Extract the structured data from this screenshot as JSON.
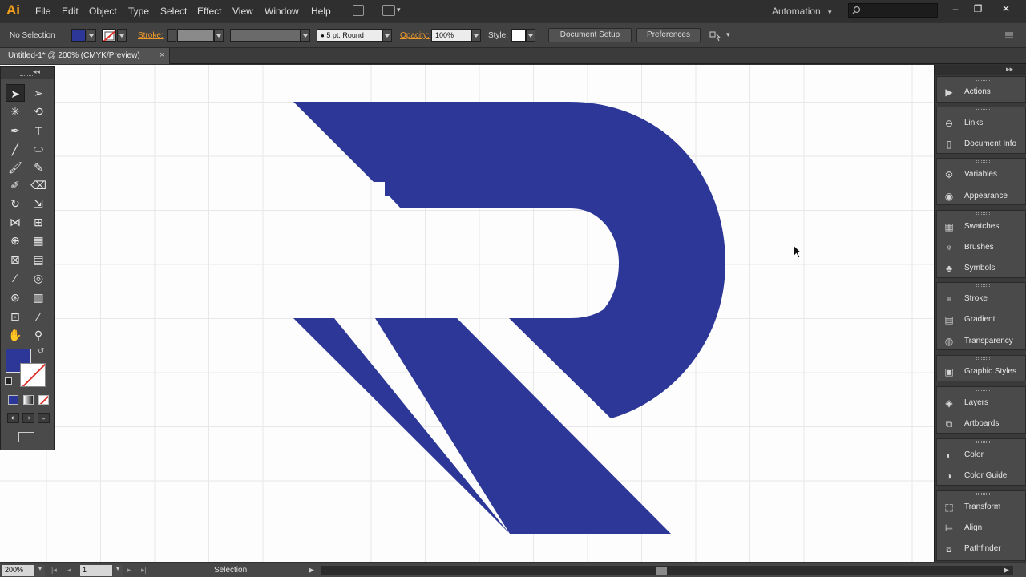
{
  "app": {
    "logo": "Ai"
  },
  "menu": [
    "File",
    "Edit",
    "Object",
    "Type",
    "Select",
    "Effect",
    "View",
    "Window",
    "Help"
  ],
  "workspace": {
    "label": "Automation",
    "arrow": "▾"
  },
  "window_controls": {
    "minimize": "–",
    "restore": "❐",
    "close": "✕"
  },
  "control_bar": {
    "selection_label": "No Selection",
    "fill_color": "#2c3797",
    "stroke_label": "Stroke:",
    "brush_value": "5 pt. Round",
    "opacity_label": "Opacity:",
    "opacity_value": "100%",
    "style_label": "Style:",
    "document_setup": "Document Setup",
    "preferences": "Preferences"
  },
  "document_tab": {
    "title": "Untitled-1* @ 200% (CMYK/Preview)",
    "close": "×"
  },
  "artwork": {
    "color": "#2c3797"
  },
  "panels": [
    {
      "label": "Actions",
      "icon": "play-icon"
    },
    {
      "label": "Links",
      "icon": "link-icon"
    },
    {
      "label": "Document Info",
      "icon": "document-info-icon"
    },
    {
      "label": "Variables",
      "icon": "variables-icon"
    },
    {
      "label": "Appearance",
      "icon": "appearance-icon"
    },
    {
      "label": "Swatches",
      "icon": "swatches-icon"
    },
    {
      "label": "Brushes",
      "icon": "brushes-icon"
    },
    {
      "label": "Symbols",
      "icon": "symbols-icon"
    },
    {
      "label": "Stroke",
      "icon": "stroke-icon"
    },
    {
      "label": "Gradient",
      "icon": "gradient-icon"
    },
    {
      "label": "Transparency",
      "icon": "transparency-icon"
    },
    {
      "label": "Graphic Styles",
      "icon": "graphic-styles-icon"
    },
    {
      "label": "Layers",
      "icon": "layers-icon"
    },
    {
      "label": "Artboards",
      "icon": "artboards-icon"
    },
    {
      "label": "Color",
      "icon": "color-icon"
    },
    {
      "label": "Color Guide",
      "icon": "color-guide-icon"
    },
    {
      "label": "Transform",
      "icon": "transform-icon"
    },
    {
      "label": "Align",
      "icon": "align-icon"
    },
    {
      "label": "Pathfinder",
      "icon": "pathfinder-icon"
    }
  ],
  "status_bar": {
    "zoom": "200%",
    "page": "1",
    "status": "Selection"
  }
}
